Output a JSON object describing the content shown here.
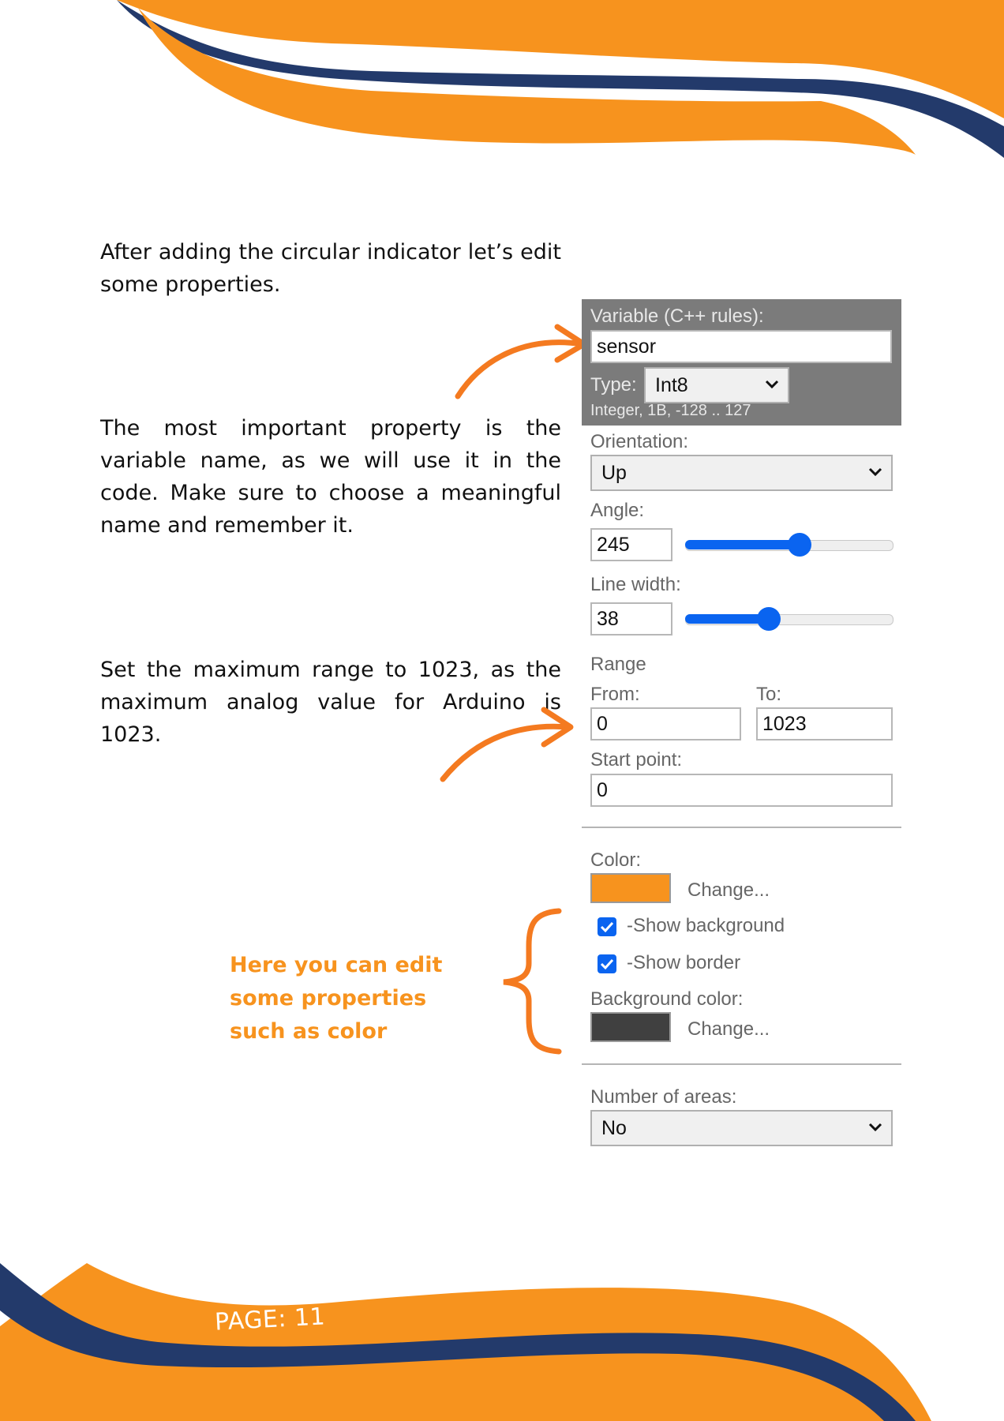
{
  "paragraphs": {
    "intro": "After adding the circular indicator let’s edit some properties.",
    "variable_note": "The most important property is the variable name, as we will use it in the code. Make sure to choose a meaningful name and remember it.",
    "range_note": "Set the maximum range to 1023, as the maximum analog value for Arduino is 1023."
  },
  "callout": "Here you can edit some properties such as color",
  "footer": {
    "page_label": "PAGE: 11"
  },
  "colors": {
    "orange": "#f7931e",
    "navy": "#233a6b",
    "accent_blue": "#0a64f0"
  },
  "panel": {
    "variable": {
      "label": "Variable (C++ rules):",
      "value": "sensor"
    },
    "type": {
      "label": "Type:",
      "selected": "Int8",
      "hint": "Integer, 1B, -128 .. 127"
    },
    "orientation": {
      "label": "Orientation:",
      "selected": "Up"
    },
    "angle": {
      "label": "Angle:",
      "value": "245",
      "slider_fraction": 0.55
    },
    "line_width": {
      "label": "Line width:",
      "value": "38",
      "slider_fraction": 0.4
    },
    "range": {
      "label": "Range",
      "from_label": "From:",
      "from_value": "0",
      "to_label": "To:",
      "to_value": "1023"
    },
    "start_point": {
      "label": "Start point:",
      "value": "0"
    },
    "color": {
      "label": "Color:",
      "change_label": "Change...",
      "value": "#f7931e"
    },
    "show_background": {
      "label": "-Show background",
      "checked": true
    },
    "show_border": {
      "label": "-Show border",
      "checked": true
    },
    "background_color": {
      "label": "Background color:",
      "change_label": "Change...",
      "value": "#404040"
    },
    "number_of_areas": {
      "label": "Number of areas:",
      "selected": "No"
    }
  }
}
